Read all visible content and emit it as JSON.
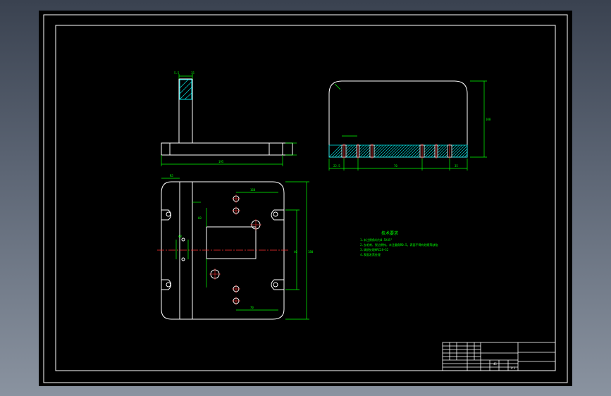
{
  "colors": {
    "frame": "#ffffff",
    "outline": "#ffffff",
    "dimension": "#00ff00",
    "centerline": "#ff3030",
    "hatch": "#00e0e0",
    "hole": "#ff3030",
    "background": "#000000"
  },
  "technical_requirements": {
    "heading": "技术要求",
    "lines": [
      "1.未注倒角均为0.5X45°",
      "2.去毛刺、锐边倒钝，未注圆角R0.5。表面不得有划痕等缺陷",
      "3.调质处理HRC28~32",
      "4.表面发黑处理"
    ]
  },
  "dimensions": {
    "top_left_a": "5.5",
    "top_left_b": "15",
    "front_width": "195",
    "side_height": "100",
    "side_bottom_1": "22.5",
    "side_bottom_2": "70",
    "side_bottom_3": "35",
    "plan_height": "180",
    "plan_width": "160",
    "plan_offset": "60",
    "plan_hole": "Φ8",
    "plan_pitch": "40",
    "plan_slot": "R5",
    "plan_inner": "70"
  },
  "title_block": {
    "material": "45",
    "scale": "1:2"
  }
}
